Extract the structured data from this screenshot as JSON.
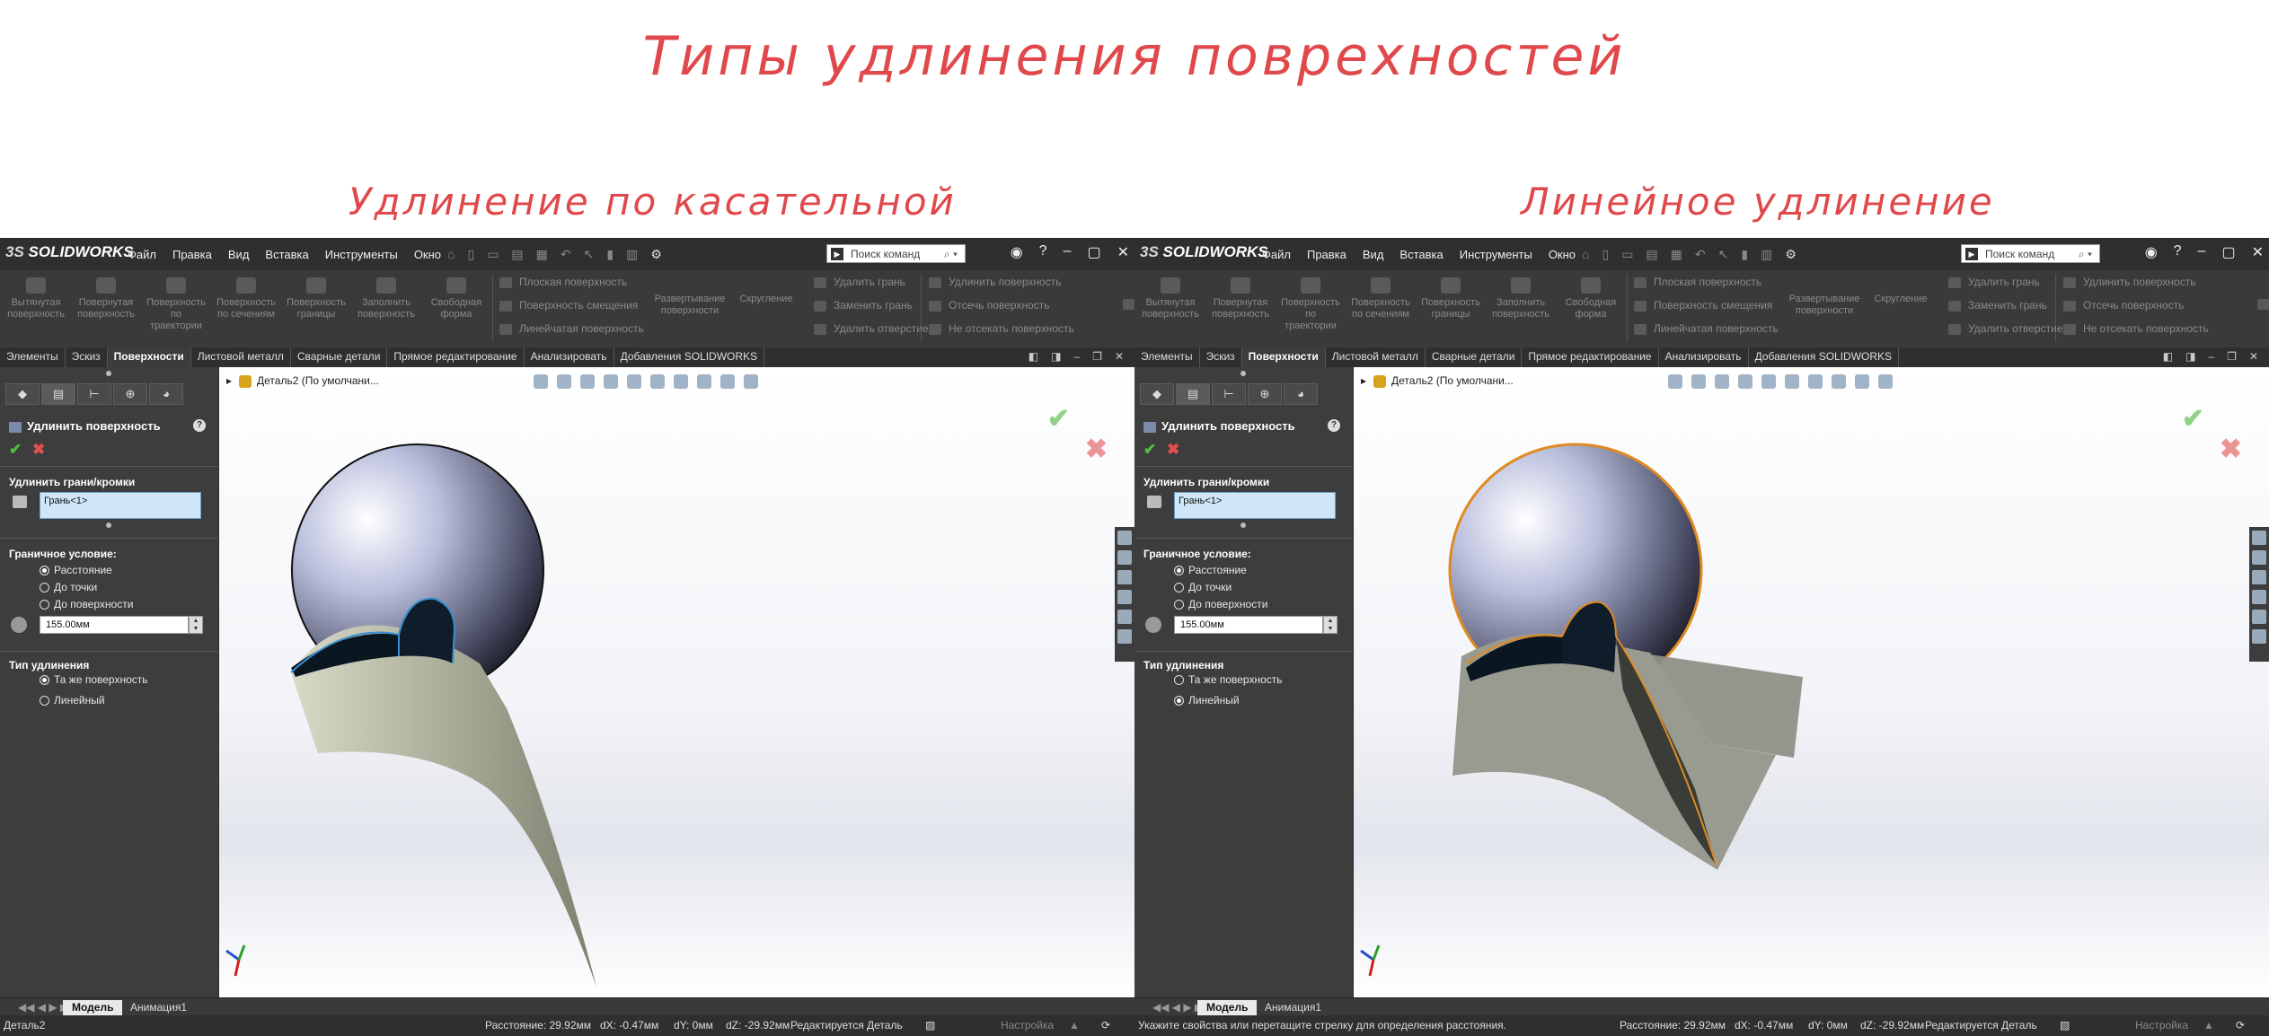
{
  "title": "Типы удлинения поврехностей",
  "subtitles": {
    "left": "Удлинение по касательной",
    "right": "Линейное удлинение"
  },
  "colors": {
    "title": "#e0484b",
    "edge_highlight_left": "#3a8fd0",
    "edge_highlight_right": "#e08a20"
  },
  "app": {
    "logo": "SOLIDWORKS",
    "menu": [
      "Файл",
      "Правка",
      "Вид",
      "Вставка",
      "Инструменты",
      "Окно"
    ],
    "search_placeholder": "Поиск команд",
    "ribbon": {
      "big": [
        "Вытянутая поверхность",
        "Повернутая поверхность",
        "Поверхность по траектории",
        "Поверхность по сечениям",
        "Поверхность границы",
        "Заполнить поверхность",
        "Свободная форма"
      ],
      "small_col1": [
        "Плоская поверхность",
        "Поверхность смещения",
        "Линейчатая поверхность"
      ],
      "unfold": "Развертывание поверхности",
      "fillet": "Скругление",
      "small_col2": [
        "Удалить грань",
        "Заменить грань",
        "Удалить отверстие"
      ],
      "small_col3": [
        "Удлинить поверхность",
        "Отсечь поверхность",
        "Не отсекать поверхность"
      ]
    },
    "tabs": [
      "Элементы",
      "Эскиз",
      "Поверхности",
      "Листовой металл",
      "Сварные детали",
      "Прямое редактирование",
      "Анализировать",
      "Добавления SOLIDWORKS"
    ],
    "feature_tree_item": "Деталь2  (По умолчани...",
    "bottom_tabs": [
      "Модель",
      "Анимация1"
    ],
    "status": {
      "distance": "Расстояние: 29.92мм",
      "dx": "dX: -0.47мм",
      "dy": "dY: 0мм",
      "dz": "dZ: -29.92мм",
      "editing": "Редактируется Деталь",
      "settings": "Настройка"
    }
  },
  "left_window": {
    "panel": {
      "title": "Удлинить поверхность",
      "section_faces": "Удлинить грани/кромки",
      "selection": "Грань<1>",
      "section_end": "Граничное условие:",
      "end_options": [
        "Расстояние",
        "До точки",
        "До поверхности"
      ],
      "end_selected": 0,
      "distance": "155.00мм",
      "section_type": "Тип удлинения",
      "type_options": [
        "Та же поверхность",
        "Линейный"
      ],
      "type_selected": 0
    },
    "status_left": "Деталь2"
  },
  "right_window": {
    "panel": {
      "title": "Удлинить поверхность",
      "section_faces": "Удлинить грани/кромки",
      "selection": "Грань<1>",
      "section_end": "Граничное условие:",
      "end_options": [
        "Расстояние",
        "До точки",
        "До поверхности"
      ],
      "end_selected": 0,
      "distance": "155.00мм",
      "section_type": "Тип удлинения",
      "type_options": [
        "Та же поверхность",
        "Линейный"
      ],
      "type_selected": 1
    },
    "status_left": "Укажите свойства или перетащите стрелку для определения расстояния."
  }
}
